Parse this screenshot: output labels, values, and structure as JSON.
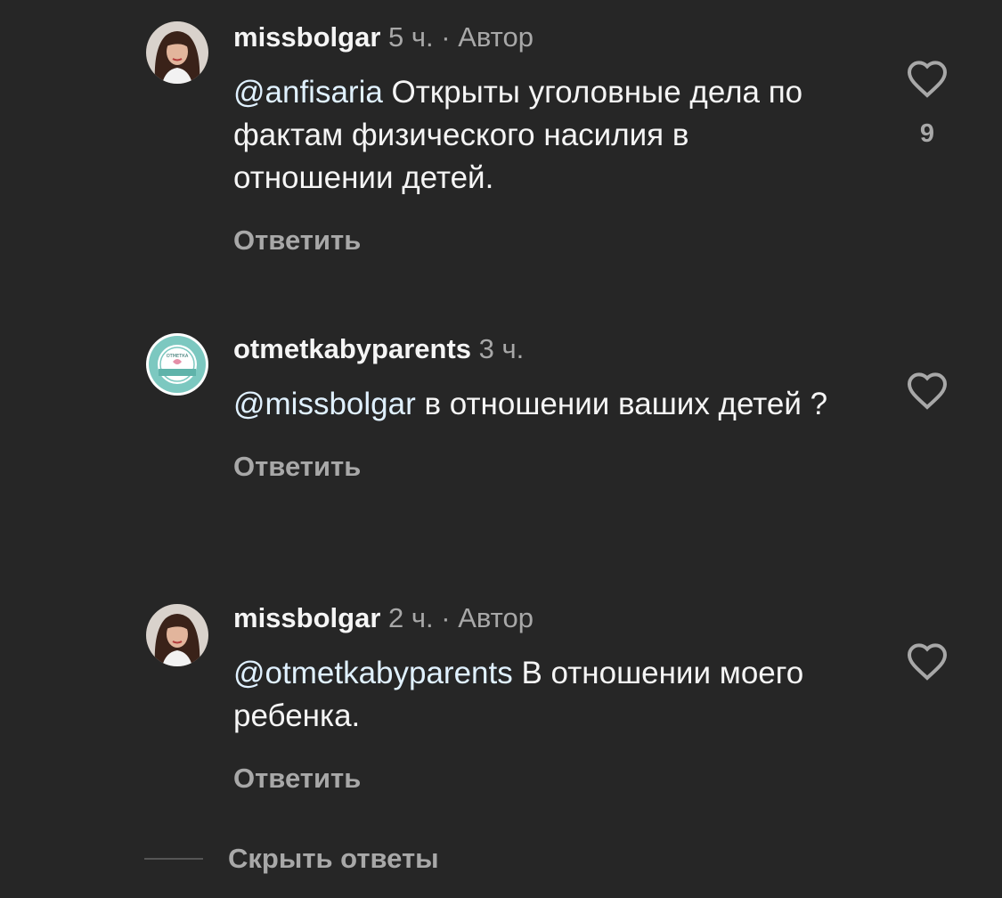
{
  "comments": [
    {
      "username": "missbolgar",
      "time": "5 ч.",
      "separator": "·",
      "author_label": "Автор",
      "mention": "@anfisaria",
      "text": " Открыты уголовные дела по фактам физического насилия в отношении детей.",
      "reply_label": "Ответить",
      "like_count": "9",
      "avatar": "portrait-woman-dark-hair"
    },
    {
      "username": "otmetkabyparents",
      "time": "3 ч.",
      "mention": "@missbolgar",
      "text": " в отношении ваших детей ?",
      "reply_label": "Ответить",
      "avatar": "otmetka-by-parents-logo"
    },
    {
      "username": "missbolgar",
      "time": "2 ч.",
      "separator": "·",
      "author_label": "Автор",
      "mention": "@otmetkabyparents",
      "text": " В отношении моего ребенка.",
      "reply_label": "Ответить",
      "avatar": "portrait-woman-dark-hair"
    }
  ],
  "hide_replies_label": "Скрыть ответы",
  "colors": {
    "background": "#262626",
    "primary_text": "#f5f5f5",
    "secondary_text": "#a8a8a8",
    "mention": "#e0f1ff",
    "logo_teal": "#7cc8c0"
  },
  "icons": {
    "like": "heart-outline-icon"
  }
}
